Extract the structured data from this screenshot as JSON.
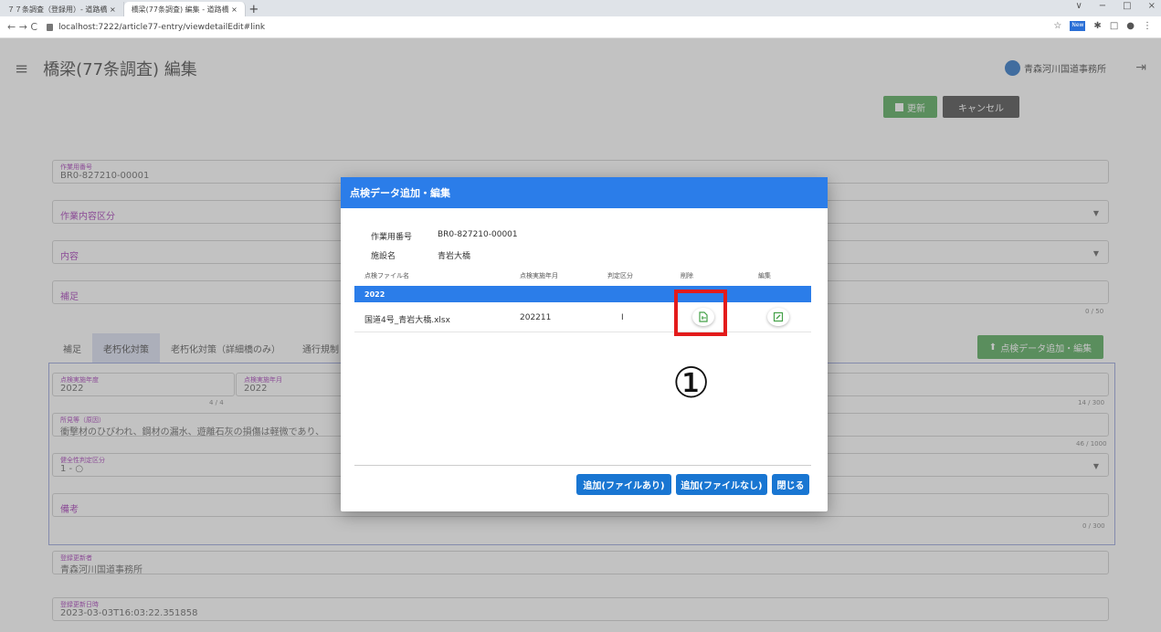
{
  "browser": {
    "tabs": [
      {
        "title": "７７条調査（登録用）- 道路橋 ×"
      },
      {
        "title": "橋梁(77条調査) 編集 - 道路橋 ×"
      }
    ],
    "new_tab": "+",
    "window_controls": [
      "∨",
      "−",
      "□",
      "×"
    ],
    "nav": "← → C",
    "url": "localhost:7222/article77-entry/viewdetailEdit#link",
    "extensions": [
      "☆",
      "New",
      "✱",
      "□",
      "●",
      "⋮"
    ]
  },
  "app": {
    "menu_icon": "≡",
    "title": "橋梁(77条調査)  編集",
    "user_name": "青森河川国道事務所",
    "logout_icon": "⇥",
    "update_button": "更新",
    "cancel_button": "キャンセル"
  },
  "form": {
    "work_number_label": "作業用番号",
    "work_number_value": "BR0-827210-00001",
    "work_content_placeholder": "作業内容区分",
    "content_placeholder": "内容",
    "remarks_placeholder": "補足",
    "remarks_counter": "0 / 50",
    "tabs": [
      "補足",
      "老朽化対策",
      "老朽化対策（詳細橋のみ）",
      "通行規制"
    ],
    "add_data_button": "点検データ追加・編集",
    "year_label": "点検実施年度",
    "year_value": "2022",
    "year2_label": "点検実施年月",
    "year2_value": "2022",
    "counter_1": "4 / 4",
    "counter_2": "14 / 300",
    "finding_label": "所見等（原因）",
    "finding_value": "衝撃材のひびわれ、鋼材の漏水、遊離石灰の損傷は軽微であり、",
    "counter_3": "46 / 1000",
    "judgement_label": "健全性判定区分",
    "judgement_value": "1 - ○",
    "note_placeholder": "備考",
    "counter_4": "0 / 300",
    "registrant_label": "登録更新者",
    "registrant_value": "青森河川国道事務所",
    "updated_label": "登録更新日時",
    "updated_value": "2023-03-03T16:03:22.351858"
  },
  "dialog": {
    "title": "点検データ追加・編集",
    "work_number_label": "作業用番号",
    "work_number_value": "BR0-827210-00001",
    "facility_label": "施設名",
    "facility_value": "青岩大橋",
    "columns": [
      "点検ファイル名",
      "点検実施年月",
      "判定区分",
      "削除",
      "編集"
    ],
    "group": "2022",
    "rows": [
      {
        "file": "国道4号_青岩大橋.xlsx",
        "date": "202211",
        "grade": "Ⅰ"
      }
    ],
    "marker": "①",
    "buttons": {
      "add_with_file": "追加(ファイルあり)",
      "add_without_file": "追加(ファイルなし)",
      "close": "閉じる"
    }
  }
}
